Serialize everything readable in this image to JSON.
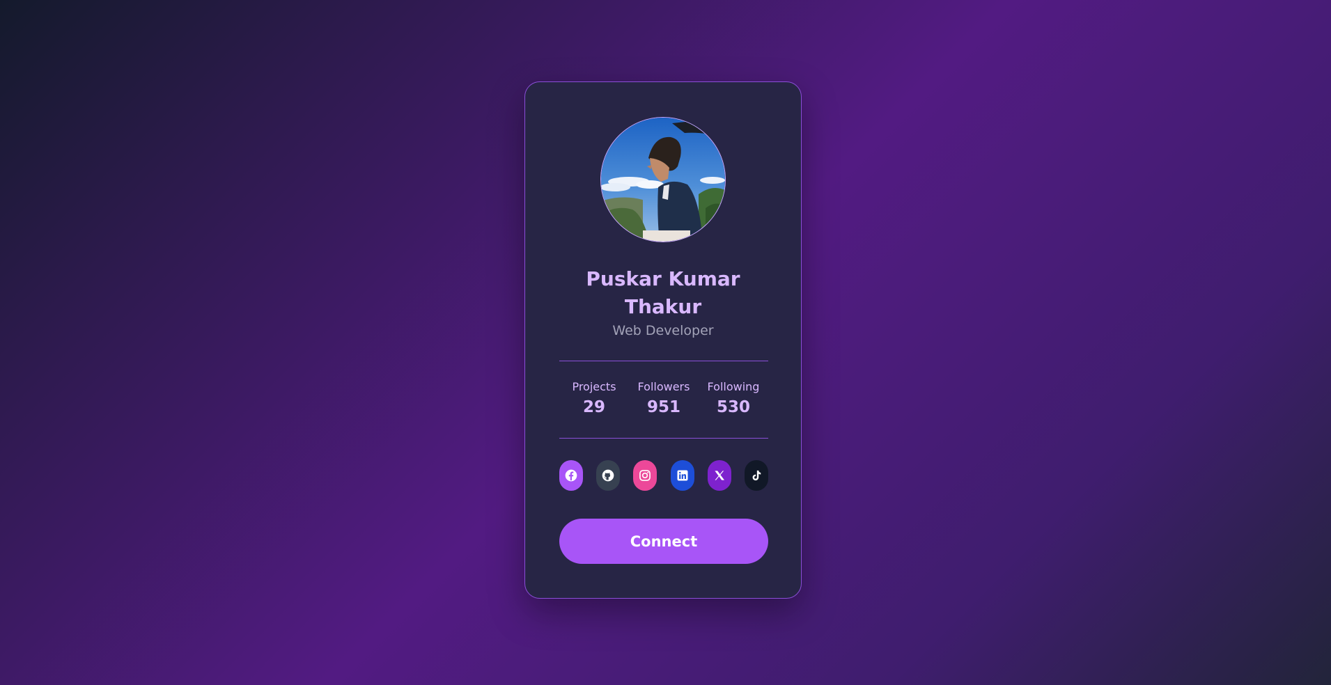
{
  "profile": {
    "name_line1": "Puskar Kumar",
    "name_line2": "Thakur",
    "role": "Web Developer"
  },
  "stats": [
    {
      "label": "Projects",
      "value": "29"
    },
    {
      "label": "Followers",
      "value": "951"
    },
    {
      "label": "Following",
      "value": "530"
    }
  ],
  "socials": [
    {
      "icon": "facebook-icon",
      "color": "#a855f7"
    },
    {
      "icon": "github-icon",
      "color": "#374151"
    },
    {
      "icon": "instagram-icon",
      "color": "#ec4899"
    },
    {
      "icon": "linkedin-icon",
      "color": "#1d4ed8"
    },
    {
      "icon": "x-twitter-icon",
      "color": "#7e22ce"
    },
    {
      "icon": "tiktok-icon",
      "color": "#111827"
    }
  ],
  "connect_label": "Connect",
  "colors": {
    "accent": "#a855f7",
    "name_text": "#d9b8ff",
    "card_bg": "#272545",
    "card_border": "#8b4fd8"
  }
}
